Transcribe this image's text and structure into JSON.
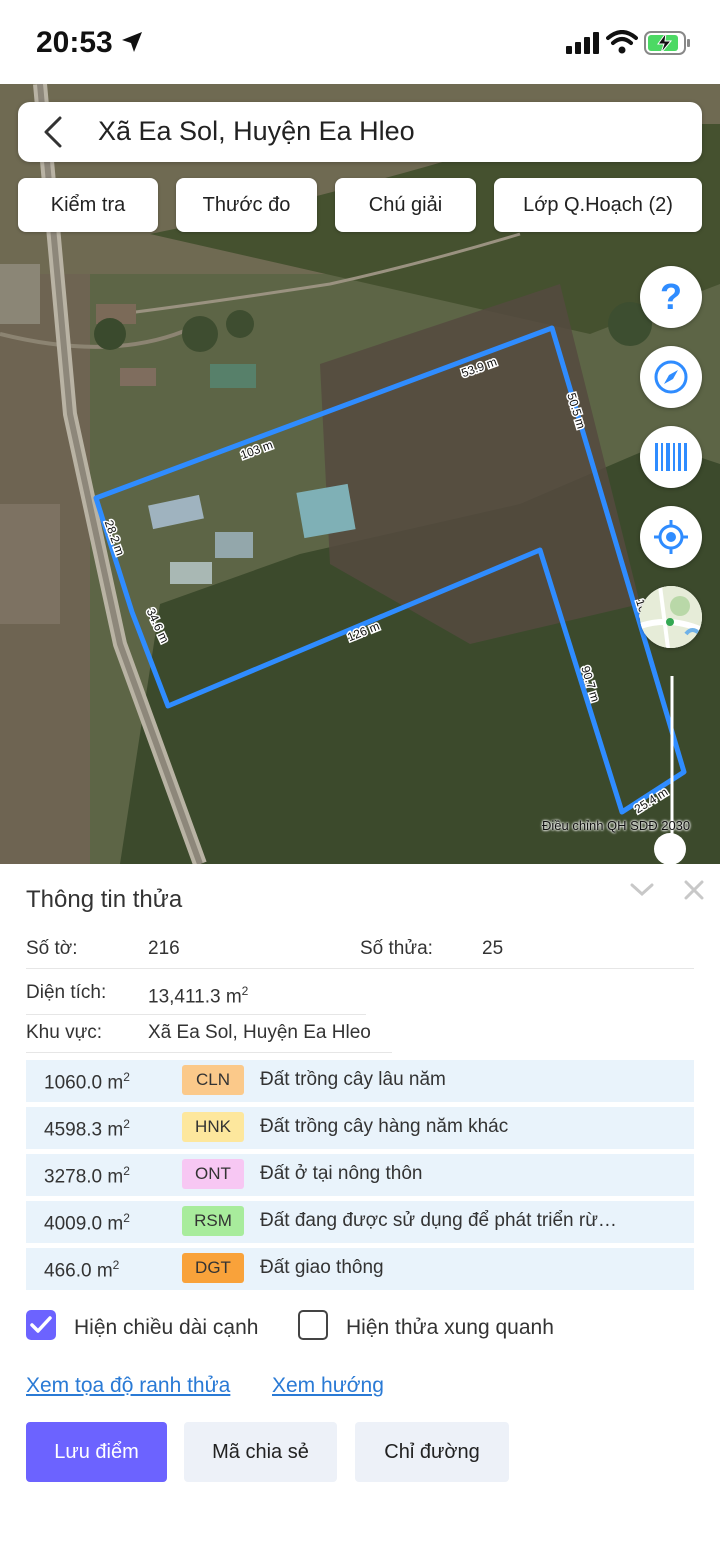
{
  "status_bar": {
    "time": "20:53"
  },
  "header": {
    "title": "Xã Ea Sol, Huyện Ea Hleo"
  },
  "chips": [
    "Kiểm tra",
    "Thước đo",
    "Chú giải",
    "Lớp Q.Hoạch (2)"
  ],
  "fab_icons": [
    "help-icon",
    "compass-icon",
    "barcode-icon",
    "locate-icon",
    "map-layer-icon"
  ],
  "map": {
    "edge_labels": [
      "53.9 m",
      "50.5 m",
      "103 m",
      "28.2 m",
      "34.6 m",
      "126 m",
      "90.7 m",
      "25.4 m",
      "100 m"
    ],
    "note": "Điều chỉnh QH SDĐ 2030",
    "boundary_color": "#2f8cff"
  },
  "panel": {
    "title": "Thông tin thửa",
    "so_to_label": "Số tờ:",
    "so_to_value": "216",
    "so_thua_label": "Số thửa:",
    "so_thua_value": "25",
    "dien_tich_label": "Diện tích:",
    "dien_tich_value": "13,411.3 m",
    "khu_vuc_label": "Khu vực:",
    "khu_vuc_value": "Xã Ea Sol, Huyện Ea Hleo",
    "land_uses": [
      {
        "area": "1060.0 m",
        "code": "CLN",
        "color": "#fbc98a",
        "desc": "Đất trồng cây lâu năm"
      },
      {
        "area": "4598.3 m",
        "code": "HNK",
        "color": "#fde79d",
        "desc": "Đất trồng cây hàng năm khác"
      },
      {
        "area": "3278.0 m",
        "code": "ONT",
        "color": "#f7c7f3",
        "desc": "Đất ở tại nông thôn"
      },
      {
        "area": "4009.0 m",
        "code": "RSM",
        "color": "#a8ec9c",
        "desc": "Đất đang được sử dụng để phát triển rừ…"
      },
      {
        "area": "466.0 m",
        "code": "DGT",
        "color": "#f9a23a",
        "desc": "Đất giao thông"
      }
    ],
    "unit_sup": "2",
    "checkbox_edges": {
      "label": "Hiện chiều dài cạnh",
      "checked": true
    },
    "checkbox_neighbors": {
      "label": "Hiện thửa xung quanh",
      "checked": false
    },
    "link_coords": "Xem tọa độ ranh thửa",
    "link_direction": "Xem hướng",
    "btn_save": "Lưu điểm",
    "btn_share": "Mã chia sẻ",
    "btn_route": "Chỉ đường",
    "accent": "#6c63ff"
  }
}
